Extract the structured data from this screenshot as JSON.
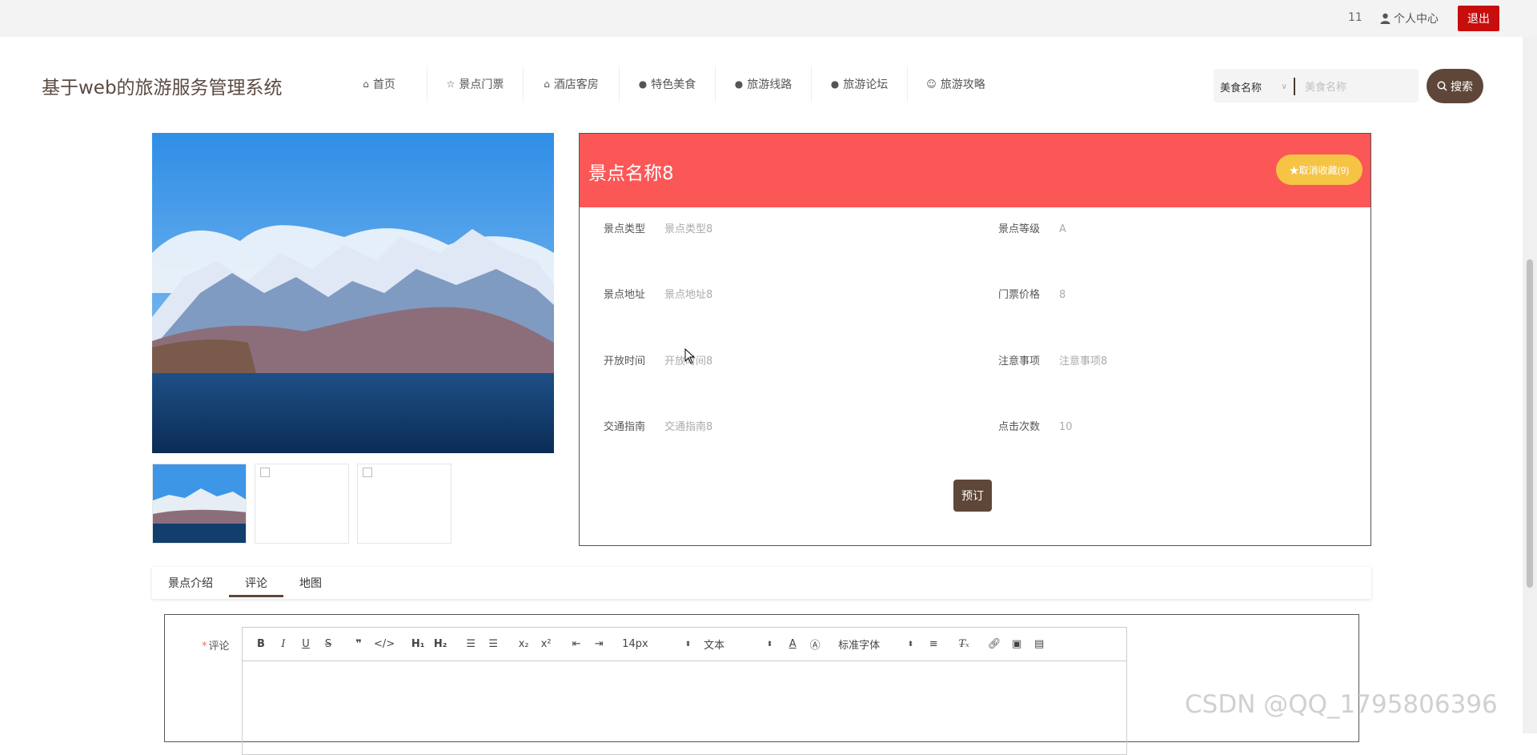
{
  "topbar": {
    "user_id": "11",
    "center_label": "个人中心",
    "logout_label": "退出"
  },
  "site_title": "基于web的旅游服务管理系统",
  "nav": [
    {
      "label": "首页",
      "icon": "home-icon"
    },
    {
      "label": "景点门票",
      "icon": "star-icon"
    },
    {
      "label": "酒店客房",
      "icon": "bag-icon"
    },
    {
      "label": "特色美食",
      "icon": "info-icon"
    },
    {
      "label": "旅游线路",
      "icon": "question-icon"
    },
    {
      "label": "旅游论坛",
      "icon": "info-icon"
    },
    {
      "label": "旅游攻略",
      "icon": "smile-icon"
    }
  ],
  "search": {
    "select_value": "美食名称",
    "placeholder": "美食名称",
    "button_label": "搜索"
  },
  "detail": {
    "name": "景点名称8",
    "fav_label": "★取消收藏(9)",
    "fields": [
      {
        "label": "景点类型",
        "value": "景点类型8"
      },
      {
        "label": "景点等级",
        "value": "A"
      },
      {
        "label": "景点地址",
        "value": "景点地址8"
      },
      {
        "label": "门票价格",
        "value": "8"
      },
      {
        "label": "开放时间",
        "value": "开放时间8"
      },
      {
        "label": "注意事项",
        "value": "注意事项8"
      },
      {
        "label": "交通指南",
        "value": "交通指南8"
      },
      {
        "label": "点击次数",
        "value": "10"
      }
    ],
    "book_label": "预订"
  },
  "tabs": [
    {
      "label": "景点介绍"
    },
    {
      "label": "评论",
      "active": true
    },
    {
      "label": "地图"
    }
  ],
  "comment": {
    "label": "评论",
    "required_mark": "*",
    "toolbar": {
      "font_size": "14px",
      "block_type": "文本",
      "font_family": "标准字体"
    }
  },
  "watermark": "CSDN @QQ_1795806396",
  "colors": {
    "accent": "#5e4739",
    "header_red": "#fb5757",
    "fav_yellow": "#f6c445",
    "logout_red": "#c80d0d"
  }
}
